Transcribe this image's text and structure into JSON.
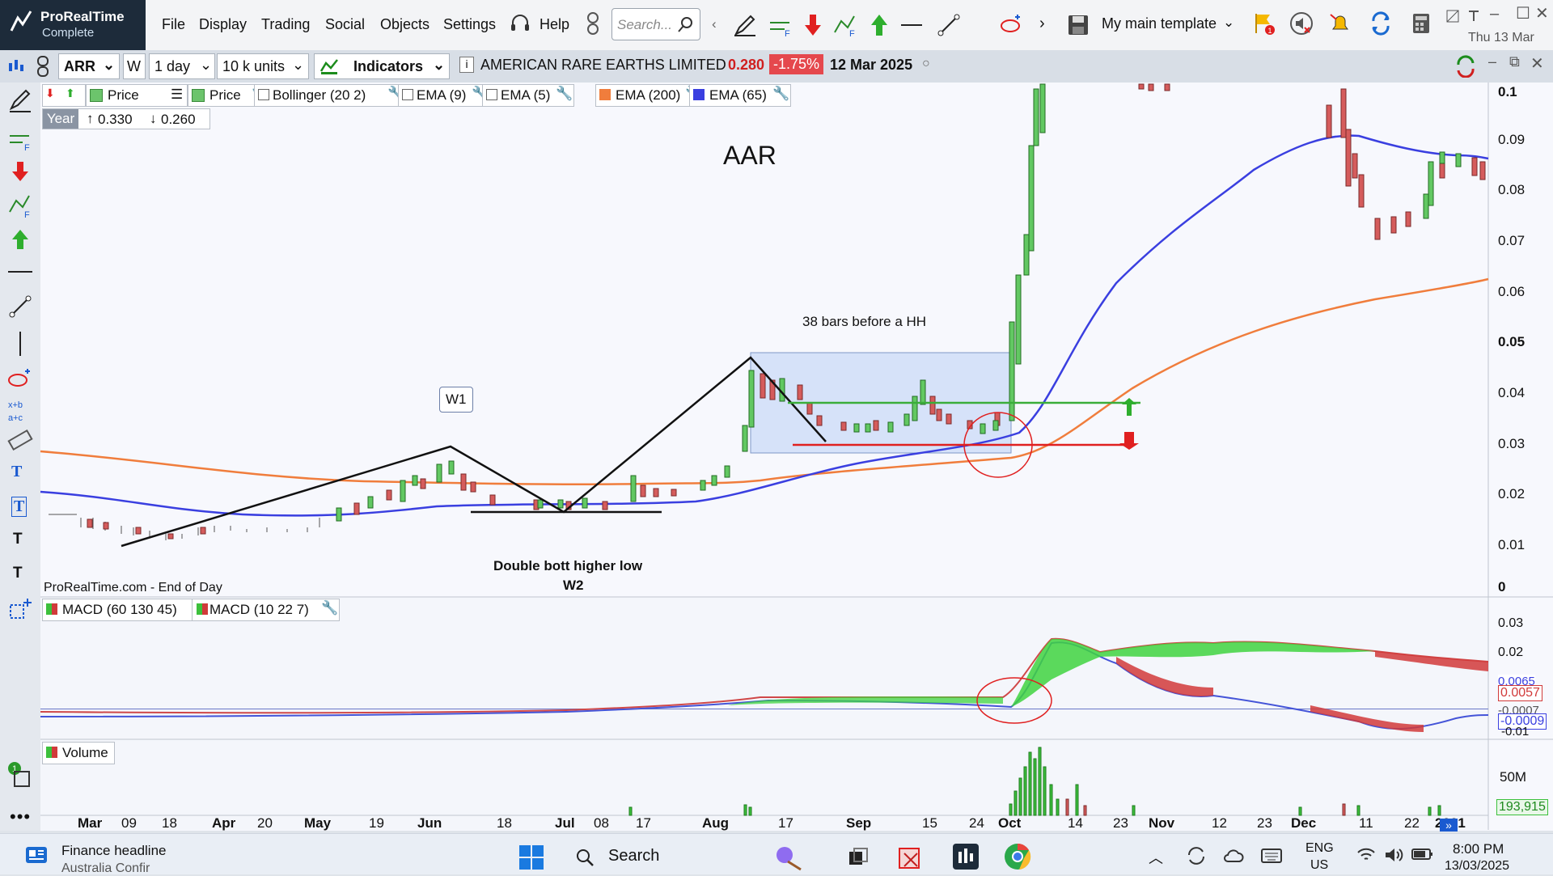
{
  "app": {
    "title": "ProRealTime",
    "edition": "Complete"
  },
  "menu": {
    "items": [
      "File",
      "Display",
      "Trading",
      "Social",
      "Objects",
      "Settings"
    ],
    "help": "Help",
    "search_placeholder": "Search...",
    "template": "My main template",
    "date_short": "Thu 13 Mar"
  },
  "toolbar2": {
    "ticker": "ARR",
    "interval": "1 day",
    "units": "10 k units",
    "indicators": "Indicators",
    "instrument": "AMERICAN RARE EARTHS LIMITED",
    "price": "0.280",
    "change": "-1.75%",
    "date": "12 Mar 2025"
  },
  "legend": {
    "price1": "Price",
    "price2": "Price",
    "bollinger": "Bollinger (20 2)",
    "ema9": "EMA (9)",
    "ema5": "EMA (5)",
    "ema200": "EMA (200)",
    "ema65": "EMA (65)"
  },
  "year_box": {
    "label": "Year",
    "high": "0.330",
    "low": "0.260"
  },
  "annotations": {
    "title": "AAR",
    "w1": "W1",
    "bars": "38 bars before a HH",
    "double1": "Double bott higher low",
    "double2": "W2",
    "source": "ProRealTime.com - End of Day"
  },
  "macd_legend": {
    "m1": "MACD (60 130 45)",
    "m2": "MACD (10 22 7)"
  },
  "volume_legend": "Volume",
  "price_axis": [
    "0.1",
    "0.09",
    "0.08",
    "0.07",
    "0.06",
    "0.05",
    "0.04",
    "0.03",
    "0.02",
    "0.01",
    "0"
  ],
  "macd_axis": {
    "ticks": [
      "0.03",
      "0.02",
      "-0.01"
    ],
    "badge_red": "0.0057",
    "badge_blue": "-0.0009",
    "badge_top": "0.0065",
    "badge_mid": "-0.0007"
  },
  "volume_axis": {
    "tick": "50M",
    "badge": "193,915"
  },
  "time_axis": [
    "Mar",
    "09",
    "18",
    "Apr",
    "20",
    "May",
    "19",
    "Jun",
    "18",
    "Jul",
    "08",
    "17",
    "Aug",
    "17",
    "Sep",
    "15",
    "24",
    "Oct",
    "14",
    "23",
    "Nov",
    "12",
    "23",
    "Dec",
    "11",
    "22",
    "2021"
  ],
  "taskbar": {
    "news1": "Finance headline",
    "news2": "Australia Confir",
    "search": "Search",
    "lang1": "ENG",
    "lang2": "US",
    "time": "8:00 PM",
    "date": "13/03/2025"
  },
  "colors": {
    "ema65": "#3a3fe0",
    "ema200": "#f07d3c",
    "up": "#3cc03c",
    "down": "#d53a3a",
    "logo_bg": "#1d2b3a"
  },
  "chart_data": {
    "type": "line",
    "title": "AAR",
    "x": [
      "Mar",
      "Apr",
      "May",
      "Jun",
      "Jul",
      "Aug",
      "Sep",
      "Oct",
      "Nov",
      "Dec",
      "Jan"
    ],
    "series": [
      {
        "name": "Price",
        "values": [
          0.015,
          0.012,
          0.015,
          0.025,
          0.018,
          0.02,
          0.035,
          0.033,
          0.1,
          0.1,
          0.085
        ]
      },
      {
        "name": "EMA (65)",
        "values": [
          0.02,
          0.017,
          0.016,
          0.018,
          0.018,
          0.019,
          0.027,
          0.032,
          0.075,
          0.09,
          0.086
        ]
      },
      {
        "name": "EMA (200)",
        "values": [
          0.028,
          0.027,
          0.025,
          0.022,
          0.021,
          0.022,
          0.025,
          0.028,
          0.045,
          0.055,
          0.062
        ]
      }
    ],
    "ylim": [
      0,
      0.1
    ]
  }
}
